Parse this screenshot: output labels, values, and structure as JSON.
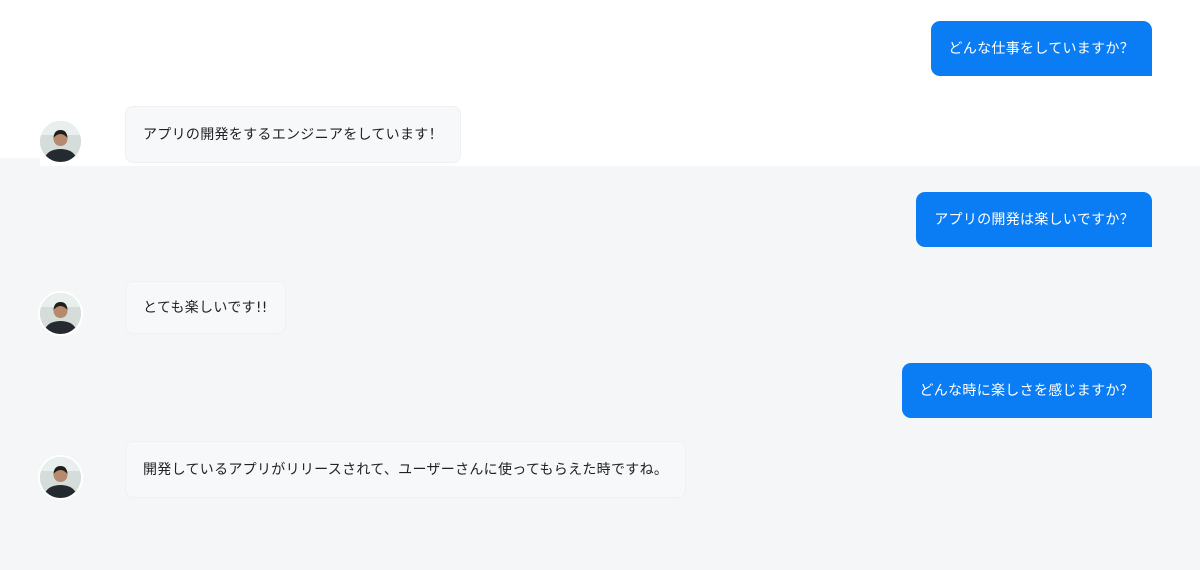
{
  "conversation": [
    {
      "role": "user",
      "text": "どんな仕事をしていますか？"
    },
    {
      "role": "bot",
      "text": "アプリの開発をするエンジニアをしています！",
      "avatar_icon": "person-avatar-icon"
    },
    {
      "role": "user",
      "text": "アプリの開発は楽しいですか？"
    },
    {
      "role": "bot",
      "text": "とても楽しいです!!",
      "avatar_icon": "person-avatar-icon"
    },
    {
      "role": "user",
      "text": "どんな時に楽しさを感じますか？"
    },
    {
      "role": "bot",
      "text": "開発しているアプリがリリースされて、ユーザーさんに使ってもらえた時ですね。",
      "avatar_icon": "person-avatar-icon"
    }
  ],
  "colors": {
    "user_bubble": "#0a7df5",
    "user_text": "#ffffff",
    "bot_bubble": "#f7f8fa",
    "bot_text": "#222222",
    "background_top": "#ffffff",
    "background_bottom": "#f5f6f8"
  }
}
